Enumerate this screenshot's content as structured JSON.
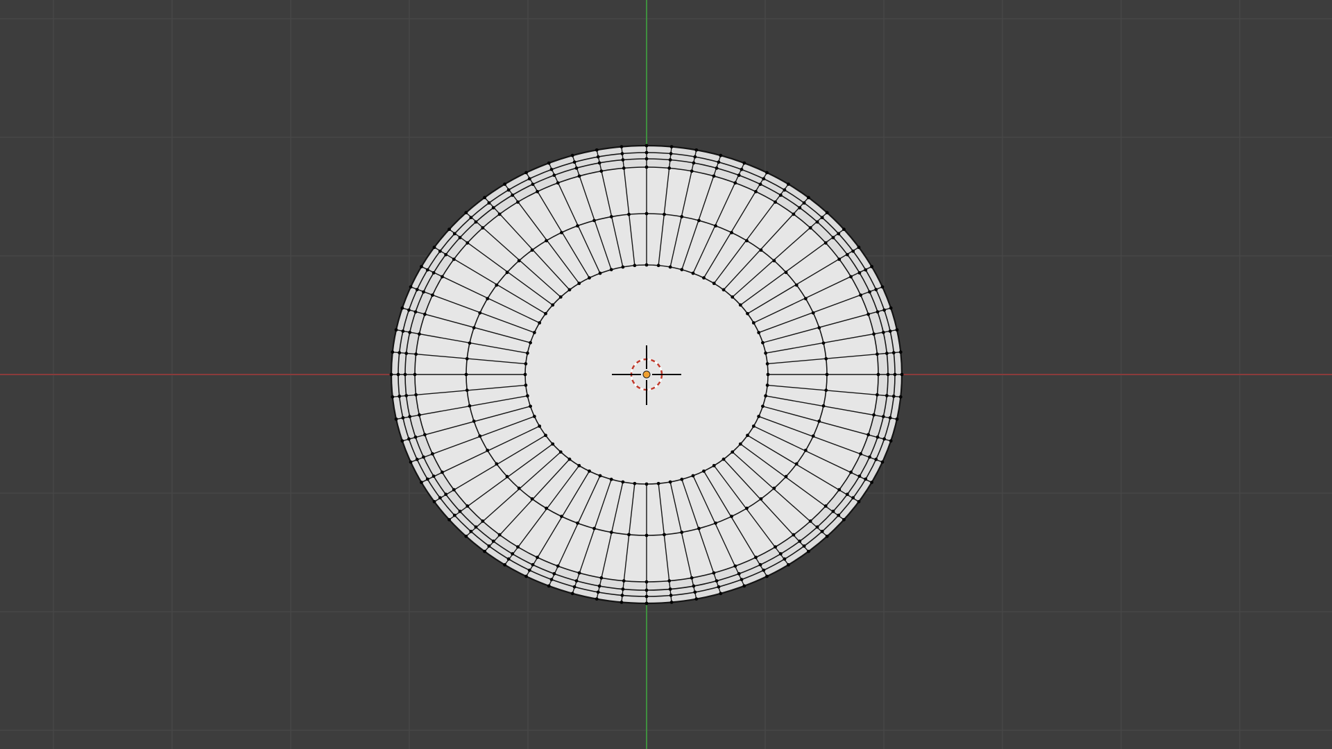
{
  "viewport": {
    "background_color": "#3d3d3d",
    "grid_color": "#474747",
    "x_axis_color": "#8a3b3b",
    "y_axis_color": "#3f8f3f"
  },
  "mesh": {
    "fill_color": "#e6e6e6",
    "ring_fill_color": "#dcdcdc",
    "edge_color": "#141414",
    "vertex_color": "#000000",
    "segments": 64
  },
  "cursor_3d": {
    "ring_colors": [
      "#c0392b",
      "#ffffff"
    ],
    "crosshair_color": "#000000"
  },
  "origin_marker": {
    "color": "#f0a030"
  }
}
